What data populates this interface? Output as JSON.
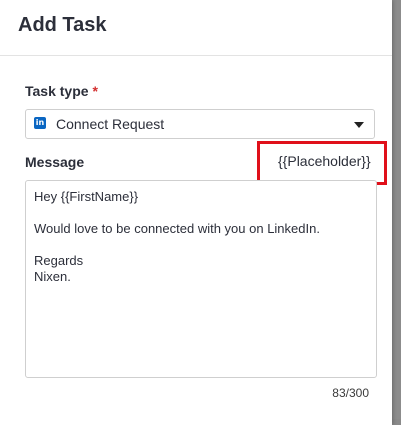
{
  "modal": {
    "title": "Add Task"
  },
  "task_type": {
    "label": "Task type",
    "required_marker": "*",
    "selected": "Connect Request",
    "icon": "linkedin-icon",
    "icon_glyph": "in"
  },
  "message": {
    "label": "Message",
    "placeholder_button": "{{Placeholder}}",
    "value": "Hey {{FirstName}}\n\nWould love to be connected with you on LinkedIn.\n\nRegards\nNixen.",
    "counter": "83/300"
  },
  "colors": {
    "highlight_border": "#e0101a",
    "required": "#d32f2f",
    "linkedin_blue": "#0a66c2"
  }
}
